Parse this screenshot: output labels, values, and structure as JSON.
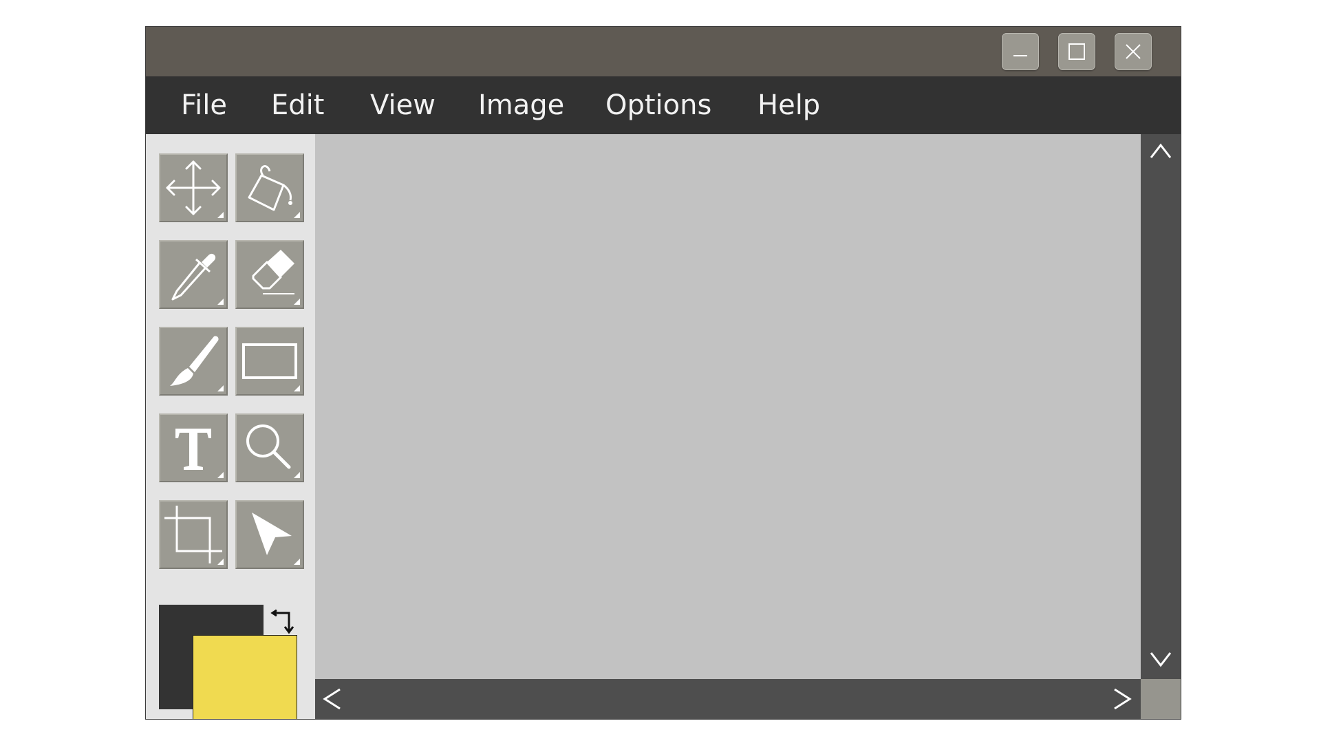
{
  "window": {
    "controls": {
      "minimize": "minimize-icon",
      "maximize": "maximize-icon",
      "close": "close-icon"
    }
  },
  "menu": [
    {
      "label": "File"
    },
    {
      "label": "Edit"
    },
    {
      "label": "View"
    },
    {
      "label": "Image"
    },
    {
      "label": "Options"
    },
    {
      "label": "Help"
    }
  ],
  "tools": [
    {
      "name": "move",
      "icon": "move-icon"
    },
    {
      "name": "fill",
      "icon": "paint-bucket-icon"
    },
    {
      "name": "eyedropper",
      "icon": "eyedropper-icon"
    },
    {
      "name": "eraser",
      "icon": "eraser-icon"
    },
    {
      "name": "brush",
      "icon": "brush-icon"
    },
    {
      "name": "rectangle",
      "icon": "rectangle-icon"
    },
    {
      "name": "text",
      "icon": "text-icon"
    },
    {
      "name": "zoom",
      "icon": "magnifier-icon"
    },
    {
      "name": "crop",
      "icon": "crop-icon"
    },
    {
      "name": "select",
      "icon": "pointer-arrow-icon"
    }
  ],
  "colors": {
    "foreground": "#333333",
    "background": "#f0da50",
    "swap_icon": "swap-colors-icon"
  },
  "theme": {
    "titlebar": "#5f5a53",
    "menubar": "#323232",
    "toolbox": "#e4e4e4",
    "canvas": "#c2c2c2",
    "scrollbar": "#4e4e4e",
    "tool_button": "#9b9a92"
  }
}
